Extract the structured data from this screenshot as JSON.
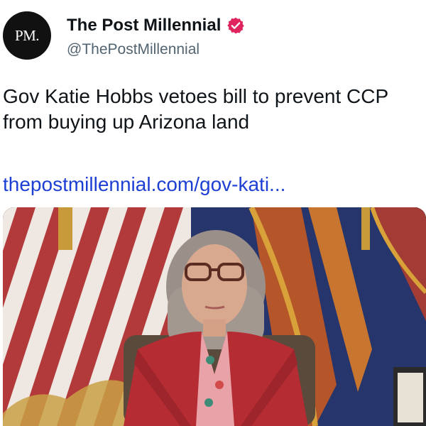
{
  "account": {
    "avatar_text": "PM.",
    "display_name": "The Post Millennial",
    "handle": "@ThePostMillennial",
    "verified_badge": "verified-badge-icon",
    "badge_color": "#e0245e"
  },
  "tweet": {
    "text": "Gov Katie Hobbs vetoes bill to prevent CCP from buying up Arizona land",
    "link": "thepostmillennial.com/gov-kati..."
  },
  "colors": {
    "text": "#0f1419",
    "secondary": "#536471",
    "link": "#1d3fd4"
  }
}
